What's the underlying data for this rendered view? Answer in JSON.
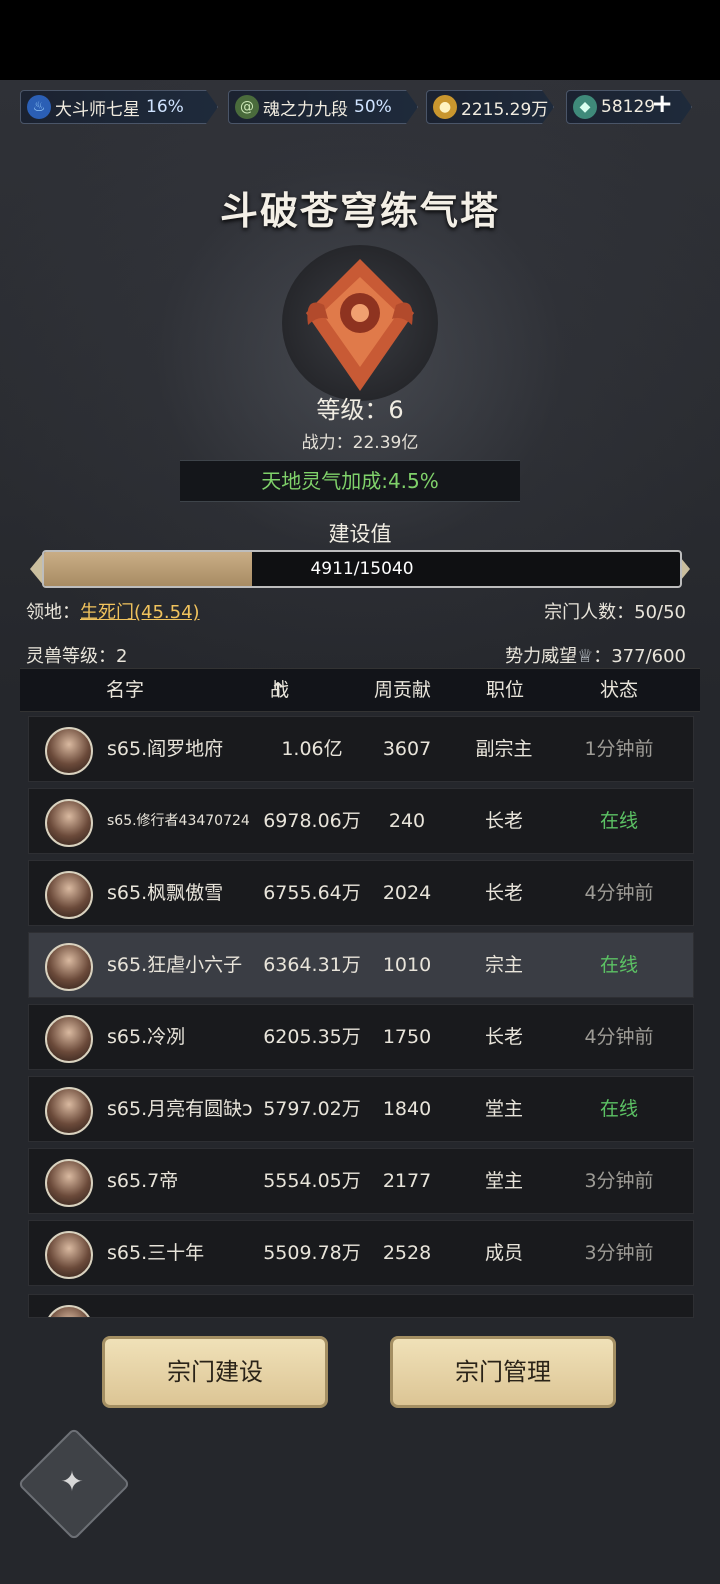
{
  "resources": [
    {
      "label": "大斗师七星",
      "pct": "16%",
      "icon": "soul-flame-icon"
    },
    {
      "label": "魂之力九段",
      "pct": "50%",
      "icon": "spiral-icon"
    },
    {
      "label": "2215.29万",
      "pct": "",
      "icon": "coin-icon"
    },
    {
      "label": "58129",
      "pct": "",
      "icon": "jade-icon"
    }
  ],
  "plus_label": "+",
  "title": "斗破苍穹练气塔",
  "level": "等级：6",
  "power": "战力：22.39亿",
  "bonus": "天地灵气加成:4.5%",
  "build": {
    "label": "建设值",
    "text": "4911/15040",
    "current": 4911,
    "max": 15040
  },
  "territory": {
    "label": "领地：",
    "value": "生死门(45.54)"
  },
  "members": "宗门人数：50/50",
  "beast": "灵兽等级：2",
  "prestige": {
    "label": "势力威望",
    "value": "：377/600"
  },
  "columns": {
    "name": "名字",
    "power": "战力",
    "sort_arrow": "↑",
    "contrib": "周贡献",
    "position": "职位",
    "status": "状态"
  },
  "rows": [
    {
      "name": "s65.阎罗地府",
      "power": "1.06亿",
      "contrib": "3607",
      "position": "副宗主",
      "status": "1分钟前",
      "online": false
    },
    {
      "name": "s65.修行者43470724",
      "power": "6978.06万",
      "contrib": "240",
      "position": "长老",
      "status": "在线",
      "online": true
    },
    {
      "name": "s65.枫飘傲雪",
      "power": "6755.64万",
      "contrib": "2024",
      "position": "长老",
      "status": "4分钟前",
      "online": false
    },
    {
      "name": "s65.狂虐小六子",
      "power": "6364.31万",
      "contrib": "1010",
      "position": "宗主",
      "status": "在线",
      "online": true
    },
    {
      "name": "s65.冷冽",
      "power": "6205.35万",
      "contrib": "1750",
      "position": "长老",
      "status": "4分钟前",
      "online": false
    },
    {
      "name": "s65.月亮有圆缺ↄ",
      "power": "5797.02万",
      "contrib": "1840",
      "position": "堂主",
      "status": "在线",
      "online": true
    },
    {
      "name": "s65.7帝",
      "power": "5554.05万",
      "contrib": "2177",
      "position": "堂主",
      "status": "3分钟前",
      "online": false
    },
    {
      "name": "s65.三十年",
      "power": "5509.78万",
      "contrib": "2528",
      "position": "成员",
      "status": "3分钟前",
      "online": false
    }
  ],
  "buttons": {
    "build": "宗门建设",
    "manage": "宗门管理"
  }
}
